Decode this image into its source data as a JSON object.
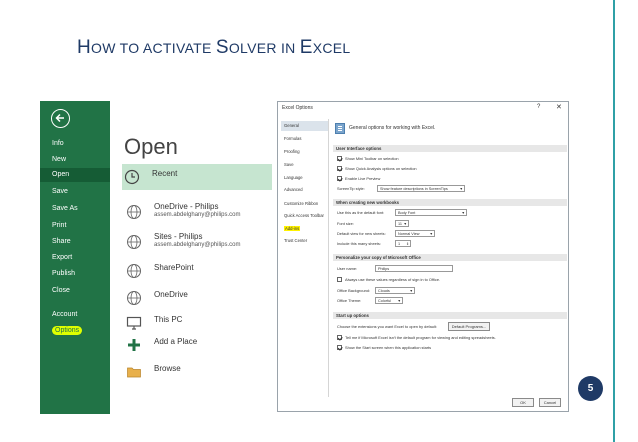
{
  "slide": {
    "title_big1": "H",
    "title_small1": "OW TO ACTIVATE ",
    "title_big2": "S",
    "title_small2": "OLVER IN ",
    "title_big3": "E",
    "title_small3": "XCEL",
    "page_number": "5",
    "accent_color": "#1f3a66"
  },
  "backstage": {
    "brand_color": "#217346",
    "nav": [
      "Info",
      "New",
      "Open",
      "Save",
      "Save As",
      "Print",
      "Share",
      "Export",
      "Publish",
      "Close",
      "Account",
      "Options"
    ],
    "heading": "Open",
    "locations": {
      "recent": "Recent",
      "onedrive_philips": "OneDrive - Philips",
      "onedrive_philips_email": "assem.abdelghany@philips.com",
      "sites_philips": "Sites - Philips",
      "sites_philips_email": "assem.abdelghany@philips.com",
      "sharepoint": "SharePoint",
      "onedrive": "OneDrive",
      "this_pc": "This PC",
      "add_place": "Add a Place",
      "browse": "Browse"
    }
  },
  "dialog": {
    "title": "Excel Options",
    "help": "?",
    "close": "✕",
    "categories": [
      "General",
      "Formulas",
      "Proofing",
      "Save",
      "Language",
      "Advanced",
      "Customize Ribbon",
      "Quick Access Toolbar",
      "Add-ins",
      "Trust Center"
    ],
    "header": "General options for working with Excel.",
    "ui_section": "User Interface options",
    "ui_opt1": "Show Mini Toolbar on selection",
    "ui_opt2": "Show Quick Analysis options on selection",
    "ui_opt3": "Enable Live Preview",
    "screentip_label": "ScreenTip style:",
    "screentip_value": "Show feature descriptions in ScreenTips",
    "wb_section": "When creating new workbooks",
    "font_label": "Use this as the default font:",
    "font_value": "Body Font",
    "size_label": "Font size:",
    "size_value": "11",
    "view_label": "Default view for new sheets:",
    "view_value": "Normal View",
    "sheets_label": "Include this many sheets:",
    "sheets_value": "1",
    "personal_section": "Personalize your copy of Microsoft Office",
    "user_label": "User name:",
    "user_value": "Philips",
    "always_label": "Always use these values regardless of sign in to Office.",
    "bg_label": "Office Background:",
    "bg_value": "Clouds",
    "theme_label": "Office Theme:",
    "theme_value": "Colorful",
    "startup_section": "Start up options",
    "ext_label": "Choose the extensions you want Excel to open by default:",
    "default_programs": "Default Programs...",
    "tell_me": "Tell me if Microsoft Excel isn't the default program for viewing and editing spreadsheets.",
    "show_start": "Show the Start screen when this application starts",
    "ok": "OK",
    "cancel": "Cancel"
  }
}
